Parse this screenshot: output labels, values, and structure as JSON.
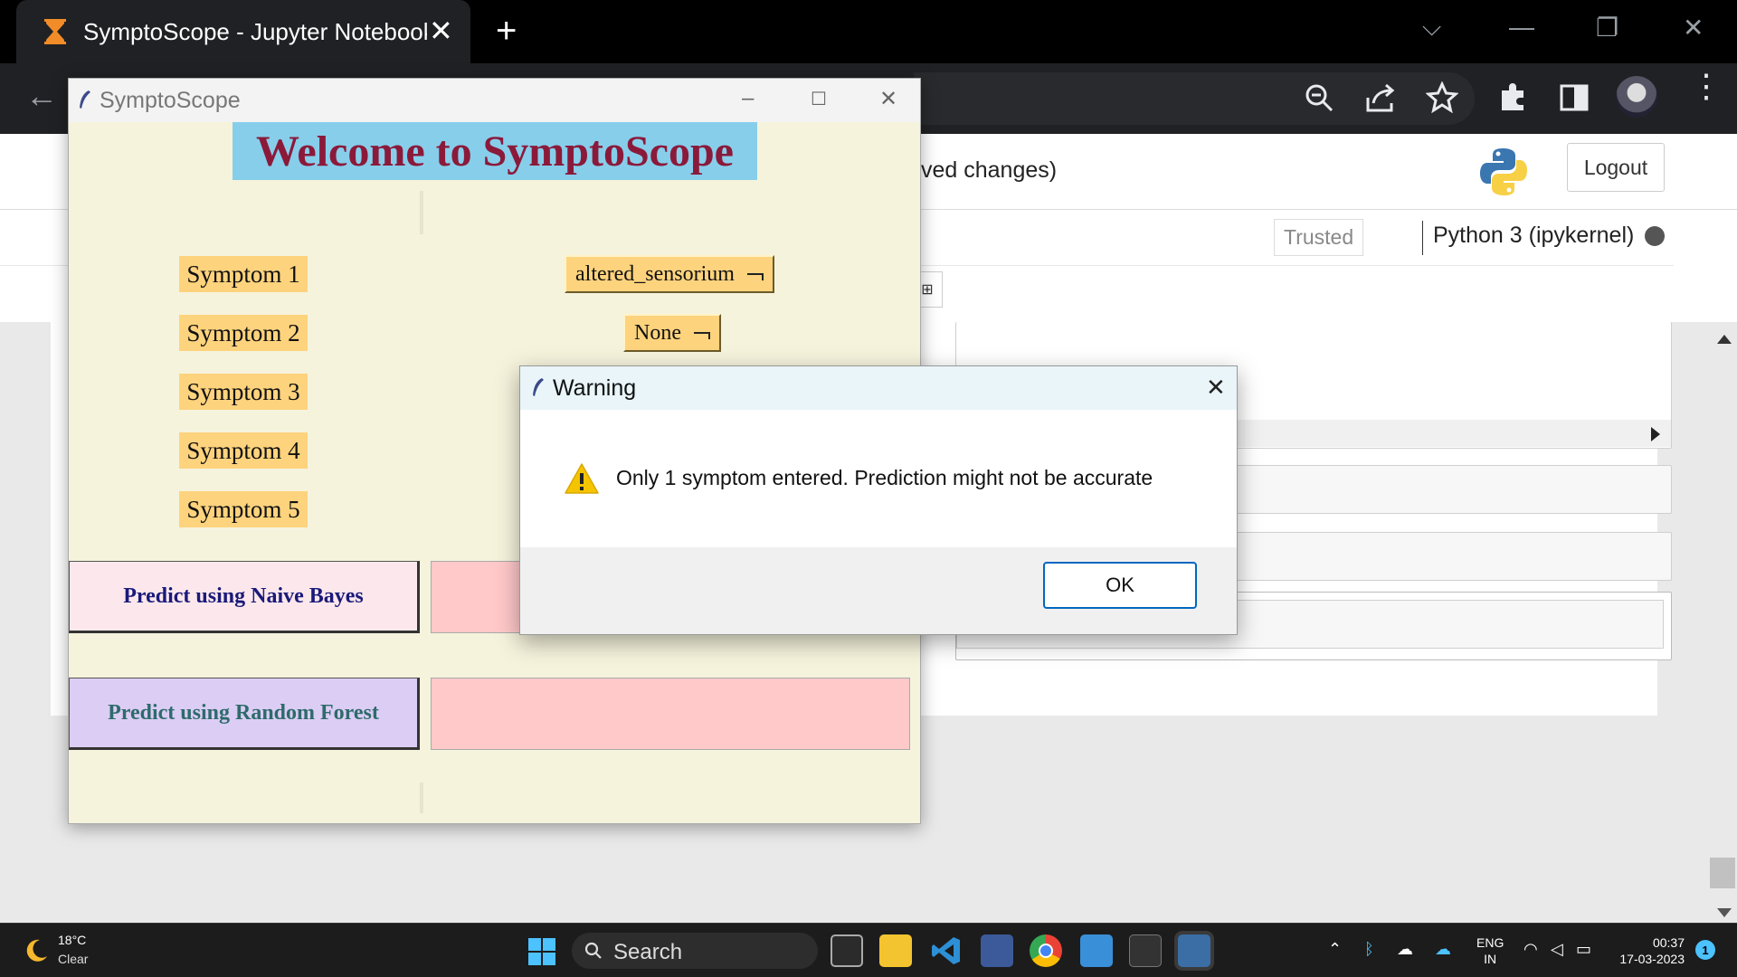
{
  "browser": {
    "tab_title": "SymptoScope - Jupyter Notebook",
    "new_tab": "+",
    "tab_close": "✕"
  },
  "jupyter": {
    "saved_status": "ved changes)",
    "logout_label": "Logout",
    "trusted_label": "Trusted",
    "kernel_name": "Python 3 (ipykernel)"
  },
  "app": {
    "window_title": "SymptoScope",
    "welcome": "Welcome to SymptoScope",
    "symptoms": [
      {
        "label": "Symptom 1",
        "value": "altered_sensorium"
      },
      {
        "label": "Symptom 2",
        "value": "None"
      },
      {
        "label": "Symptom 3"
      },
      {
        "label": "Symptom 4"
      },
      {
        "label": "Symptom 5"
      }
    ],
    "predict_nb_label": "Predict using Naive Bayes",
    "predict_rf_label": "Predict using Random Forest",
    "nb_result": "",
    "rf_result": ""
  },
  "dialog": {
    "title": "Warning",
    "message": "Only 1 symptom entered. Prediction might not be accurate",
    "ok_label": "OK"
  },
  "taskbar": {
    "temperature": "18°C",
    "condition": "Clear",
    "search_label": "Search",
    "lang_top": "ENG",
    "lang_bottom": "IN",
    "time": "00:37",
    "date": "17-03-2023",
    "notification_count": "1"
  },
  "colors": {
    "welcome_bg": "#87ceeb",
    "welcome_text": "#8b1a3a",
    "app_bg": "#f5f3dc",
    "symptom_bg": "#fed37d",
    "nb_btn_bg": "#fce8ec",
    "nb_btn_text": "#1a1a7a",
    "rf_btn_bg": "#dccdf5",
    "rf_btn_text": "#2e6b6b",
    "result_bg": "#ffc8c9",
    "ok_border": "#0067c0"
  }
}
